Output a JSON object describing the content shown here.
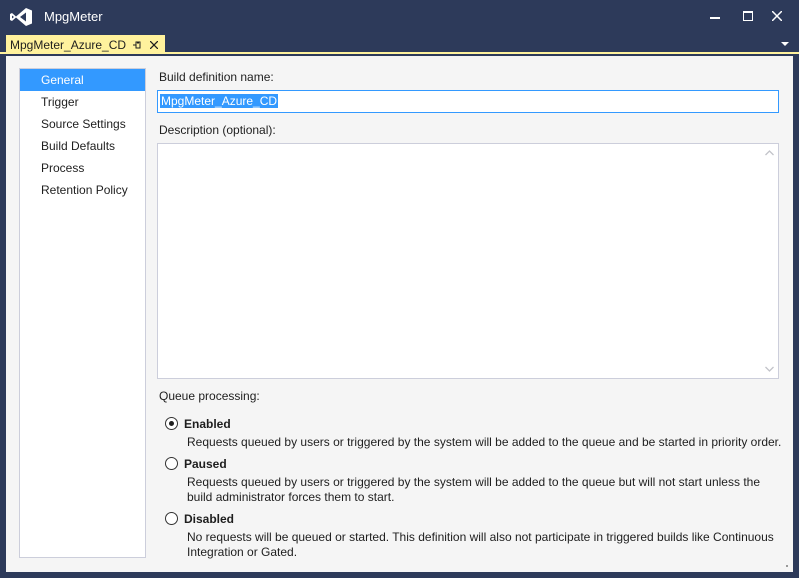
{
  "window": {
    "title": "MpgMeter",
    "minimize_symbol": "—",
    "maximize_symbol": "□",
    "close_symbol": "✕"
  },
  "tab": {
    "label": "MpgMeter_Azure_CD",
    "pin_icon": "pin-icon",
    "close_symbol": "✕"
  },
  "nav": {
    "items": [
      {
        "label": "General",
        "selected": true
      },
      {
        "label": "Trigger"
      },
      {
        "label": "Source Settings"
      },
      {
        "label": "Build Defaults"
      },
      {
        "label": "Process"
      },
      {
        "label": "Retention Policy"
      }
    ]
  },
  "general": {
    "name_label": "Build definition name:",
    "name_value": "MpgMeter_Azure_CD",
    "description_label": "Description (optional):",
    "description_value": "",
    "queue_label": "Queue processing:",
    "options": [
      {
        "title": "Enabled",
        "checked": true,
        "description": "Requests queued by users or triggered by the system will be added to the queue and be started in priority order."
      },
      {
        "title": "Paused",
        "checked": false,
        "description": "Requests queued by users or triggered by the system will be added to the queue but will not start unless the build administrator forces them to start."
      },
      {
        "title": "Disabled",
        "checked": false,
        "description": "No requests will be queued or started. This definition will also not participate in triggered builds like Continuous Integration or Gated."
      }
    ]
  },
  "colors": {
    "title_bar": "#2d3a5a",
    "tab_active": "#fff29d",
    "selection": "#3399ff",
    "panel": "#f5f5f5"
  }
}
